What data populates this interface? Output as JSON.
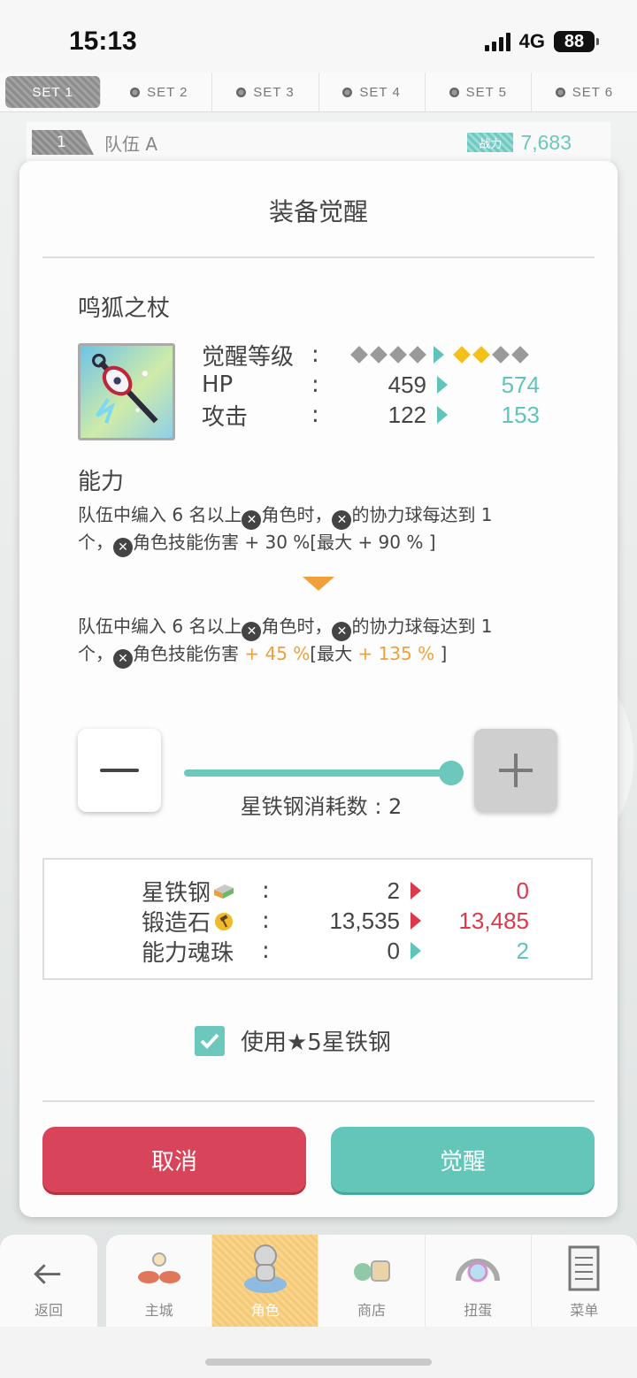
{
  "status": {
    "time": "15:13",
    "network": "4G",
    "battery": "88"
  },
  "sets": [
    "SET 1",
    "SET 2",
    "SET 3",
    "SET 4",
    "SET 5",
    "SET 6"
  ],
  "team": {
    "number": "1",
    "name": "队伍 A",
    "power_label": "战力",
    "power_value": "7,683"
  },
  "modal": {
    "title": "装备觉醒",
    "item_name": "鸣狐之杖",
    "stats": [
      {
        "label": "觉醒等级",
        "colon": ":",
        "type": "diamonds"
      },
      {
        "label": "HP",
        "colon": ":",
        "before": "459",
        "after": "574"
      },
      {
        "label": "攻击",
        "colon": ":",
        "before": "122",
        "after": "153"
      }
    ],
    "ability_title": "能力",
    "ability_before": {
      "line1_a": "队伍中编入 6 名以上",
      "line1_b": "角色时，",
      "line1_c": "的协力球每达到 1",
      "line2_a": "个，",
      "line2_b": "角色技能伤害 + 30 %[最大 + 90 % ]"
    },
    "ability_after": {
      "line1_a": "队伍中编入 6 名以上",
      "line1_b": "角色时，",
      "line1_c": "的协力球每达到 1",
      "line2_a": "个，",
      "line2_b": "角色技能伤害 ",
      "line2_hl1": "+ 45 %",
      "line2_c": "[最大 ",
      "line2_hl2": "+ 135 %",
      "line2_d": " ]"
    },
    "consume_label": "星铁钢消耗数 : 2",
    "slider_value": 1.0,
    "costs": [
      {
        "label": "星铁钢",
        "colon": ":",
        "before": "2",
        "after": "0",
        "after_color": "red",
        "arrow": "red"
      },
      {
        "label": "锻造石",
        "colon": ":",
        "before": "13,535",
        "after": "13,485",
        "after_color": "red",
        "arrow": "red"
      },
      {
        "label": "能力魂珠",
        "colon": ":",
        "before": "0",
        "after": "2",
        "after_color": "teal",
        "arrow": "teal"
      }
    ],
    "checkbox_label": "使用★5星铁钢",
    "checkbox_checked": true,
    "cancel_label": "取消",
    "confirm_label": "觉醒"
  },
  "nav": {
    "back": "返回",
    "items": [
      "主城",
      "角色",
      "商店",
      "扭蛋",
      "菜单"
    ],
    "active": "角色"
  },
  "colors": {
    "teal": "#5fc5ba",
    "red": "#d93a4c",
    "orange": "#f0a03a"
  }
}
